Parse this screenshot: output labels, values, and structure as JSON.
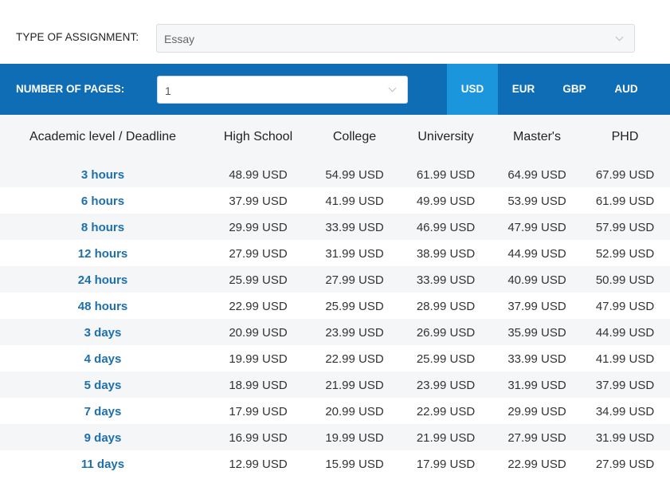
{
  "assignment": {
    "label": "TYPE OF ASSIGNMENT:",
    "value": "Essay"
  },
  "pages": {
    "label": "NUMBER OF PAGES:",
    "value": "1"
  },
  "currencies": [
    "USD",
    "EUR",
    "GBP",
    "AUD"
  ],
  "active_currency": "USD",
  "colors": {
    "bar": "#0f6db5",
    "active_tab": "#1b96dd",
    "deadline_text": "#1d6fae",
    "row_alt": "#f4f6f8"
  },
  "table": {
    "headers": [
      "Academic level / Deadline",
      "High School",
      "College",
      "University",
      "Master's",
      "PHD"
    ],
    "rows": [
      [
        "3 hours",
        "48.99 USD",
        "54.99 USD",
        "61.99 USD",
        "64.99 USD",
        "67.99 USD"
      ],
      [
        "6 hours",
        "37.99 USD",
        "41.99 USD",
        "49.99 USD",
        "53.99 USD",
        "61.99 USD"
      ],
      [
        "8 hours",
        "29.99 USD",
        "33.99 USD",
        "46.99 USD",
        "47.99 USD",
        "57.99 USD"
      ],
      [
        "12 hours",
        "27.99 USD",
        "31.99 USD",
        "38.99 USD",
        "44.99 USD",
        "52.99 USD"
      ],
      [
        "24 hours",
        "25.99 USD",
        "27.99 USD",
        "33.99 USD",
        "40.99 USD",
        "50.99 USD"
      ],
      [
        "48 hours",
        "22.99 USD",
        "25.99 USD",
        "28.99 USD",
        "37.99 USD",
        "47.99 USD"
      ],
      [
        "3 days",
        "20.99 USD",
        "23.99 USD",
        "26.99 USD",
        "35.99 USD",
        "44.99 USD"
      ],
      [
        "4 days",
        "19.99 USD",
        "22.99 USD",
        "25.99 USD",
        "33.99 USD",
        "41.99 USD"
      ],
      [
        "5 days",
        "18.99 USD",
        "21.99 USD",
        "23.99 USD",
        "31.99 USD",
        "37.99 USD"
      ],
      [
        "7 days",
        "17.99 USD",
        "20.99 USD",
        "22.99 USD",
        "29.99 USD",
        "34.99 USD"
      ],
      [
        "9 days",
        "16.99 USD",
        "19.99 USD",
        "21.99 USD",
        "27.99 USD",
        "31.99 USD"
      ],
      [
        "11 days",
        "12.99 USD",
        "15.99 USD",
        "17.99 USD",
        "22.99 USD",
        "27.99 USD"
      ]
    ]
  }
}
